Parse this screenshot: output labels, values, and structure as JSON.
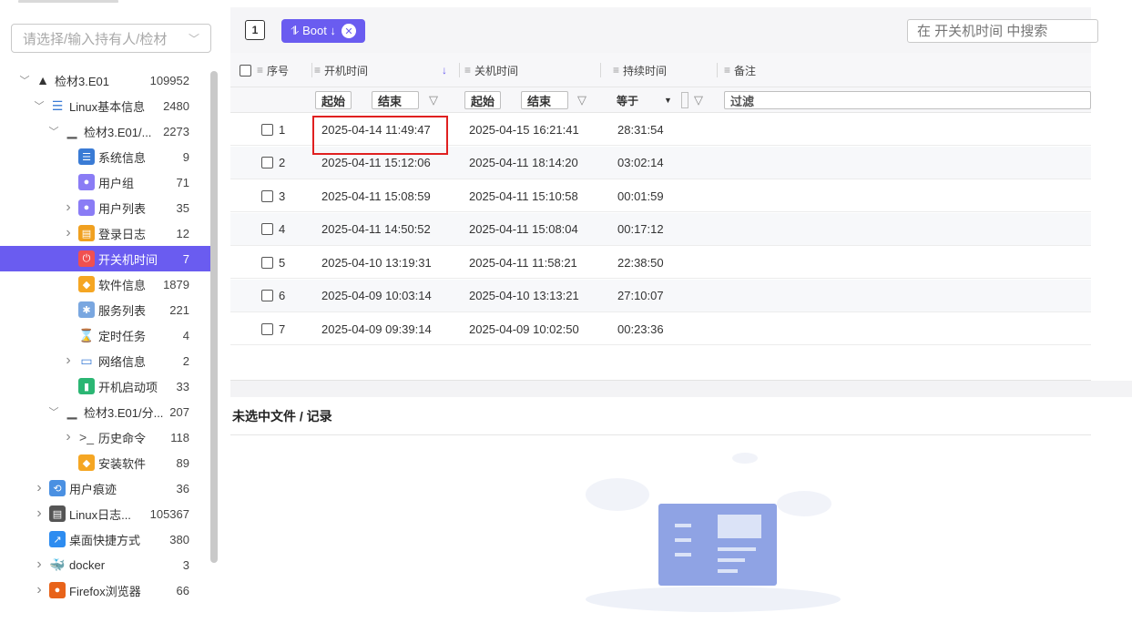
{
  "owner_select": {
    "placeholder": "请选择/输入持有人/检材"
  },
  "tree": [
    {
      "indent": 0,
      "caret": "down",
      "icon": "warning-triangle-icon",
      "label": "检材3.E01",
      "count": "109952"
    },
    {
      "indent": 1,
      "caret": "down",
      "icon": "list-icon",
      "label": "Linux基本信息",
      "count": "2480"
    },
    {
      "indent": 2,
      "caret": "down",
      "icon": "disk-icon",
      "label": "检材3.E01/...",
      "count": "2273"
    },
    {
      "indent": 3,
      "caret": "none",
      "icon": "system-info-icon",
      "label": "系统信息",
      "count": "9"
    },
    {
      "indent": 3,
      "caret": "none",
      "icon": "user-group-icon",
      "label": "用户组",
      "count": "71"
    },
    {
      "indent": 3,
      "caret": "right",
      "icon": "user-list-icon",
      "label": "用户列表",
      "count": "35"
    },
    {
      "indent": 3,
      "caret": "right",
      "icon": "login-log-icon",
      "label": "登录日志",
      "count": "12"
    },
    {
      "indent": 3,
      "caret": "none",
      "icon": "power-icon",
      "label": "开关机时间",
      "count": "7",
      "selected": true
    },
    {
      "indent": 3,
      "caret": "none",
      "icon": "software-cube-icon",
      "label": "软件信息",
      "count": "1879"
    },
    {
      "indent": 3,
      "caret": "none",
      "icon": "service-icon",
      "label": "服务列表",
      "count": "221"
    },
    {
      "indent": 3,
      "caret": "none",
      "icon": "hourglass-icon",
      "label": "定时任务",
      "count": "4"
    },
    {
      "indent": 3,
      "caret": "right",
      "icon": "network-icon",
      "label": "网络信息",
      "count": "2"
    },
    {
      "indent": 3,
      "caret": "none",
      "icon": "startup-icon",
      "label": "开机启动项",
      "count": "33"
    },
    {
      "indent": 2,
      "caret": "down",
      "icon": "disk-icon",
      "label": "检材3.E01/分...",
      "count": "207"
    },
    {
      "indent": 3,
      "caret": "right",
      "icon": "terminal-icon",
      "label": "历史命令",
      "count": "118"
    },
    {
      "indent": 3,
      "caret": "none",
      "icon": "software-cube-icon",
      "label": "安装软件",
      "count": "89"
    },
    {
      "indent": 1,
      "caret": "right",
      "icon": "user-traces-icon",
      "label": "用户痕迹",
      "count": "36"
    },
    {
      "indent": 1,
      "caret": "right",
      "icon": "linux-log-icon",
      "label": "Linux日志...",
      "count": "105367"
    },
    {
      "indent": 1,
      "caret": "none",
      "icon": "shortcut-icon",
      "label": "桌面快捷方式",
      "count": "380"
    },
    {
      "indent": 1,
      "caret": "right",
      "icon": "docker-icon",
      "label": "docker",
      "count": "3"
    },
    {
      "indent": 1,
      "caret": "right",
      "icon": "firefox-icon",
      "label": "Firefox浏览器",
      "count": "66"
    }
  ],
  "toolbar": {
    "square_label": "1",
    "sort_chip": "⥮ Boot ↓",
    "search_placeholder": "在 开关机时间 中搜索"
  },
  "table": {
    "headers": {
      "index": "序号",
      "boot": "开机时间",
      "shutdown": "关机时间",
      "duration": "持续时间",
      "note": "备注"
    },
    "filters": {
      "start1": "起始",
      "end1": "结束",
      "start2": "起始",
      "end2": "结束",
      "equals": "等于",
      "filter_placeholder": "过滤"
    },
    "rows": [
      {
        "index": "1",
        "boot": "2025-04-14 11:49:47",
        "shutdown": "2025-04-15 16:21:41",
        "duration": "28:31:54"
      },
      {
        "index": "2",
        "boot": "2025-04-11 15:12:06",
        "shutdown": "2025-04-11 18:14:20",
        "duration": "03:02:14"
      },
      {
        "index": "3",
        "boot": "2025-04-11 15:08:59",
        "shutdown": "2025-04-11 15:10:58",
        "duration": "00:01:59"
      },
      {
        "index": "4",
        "boot": "2025-04-11 14:50:52",
        "shutdown": "2025-04-11 15:08:04",
        "duration": "00:17:12"
      },
      {
        "index": "5",
        "boot": "2025-04-10 13:19:31",
        "shutdown": "2025-04-11 11:58:21",
        "duration": "22:38:50"
      },
      {
        "index": "6",
        "boot": "2025-04-09 10:03:14",
        "shutdown": "2025-04-10 13:13:21",
        "duration": "27:10:07"
      },
      {
        "index": "7",
        "boot": "2025-04-09 09:39:14",
        "shutdown": "2025-04-09 10:02:50",
        "duration": "00:23:36"
      }
    ]
  },
  "detail": {
    "title": "未选中文件 / 记录"
  },
  "colors": {
    "accent": "#6a5cf0",
    "highlight_box": "#e02020"
  }
}
